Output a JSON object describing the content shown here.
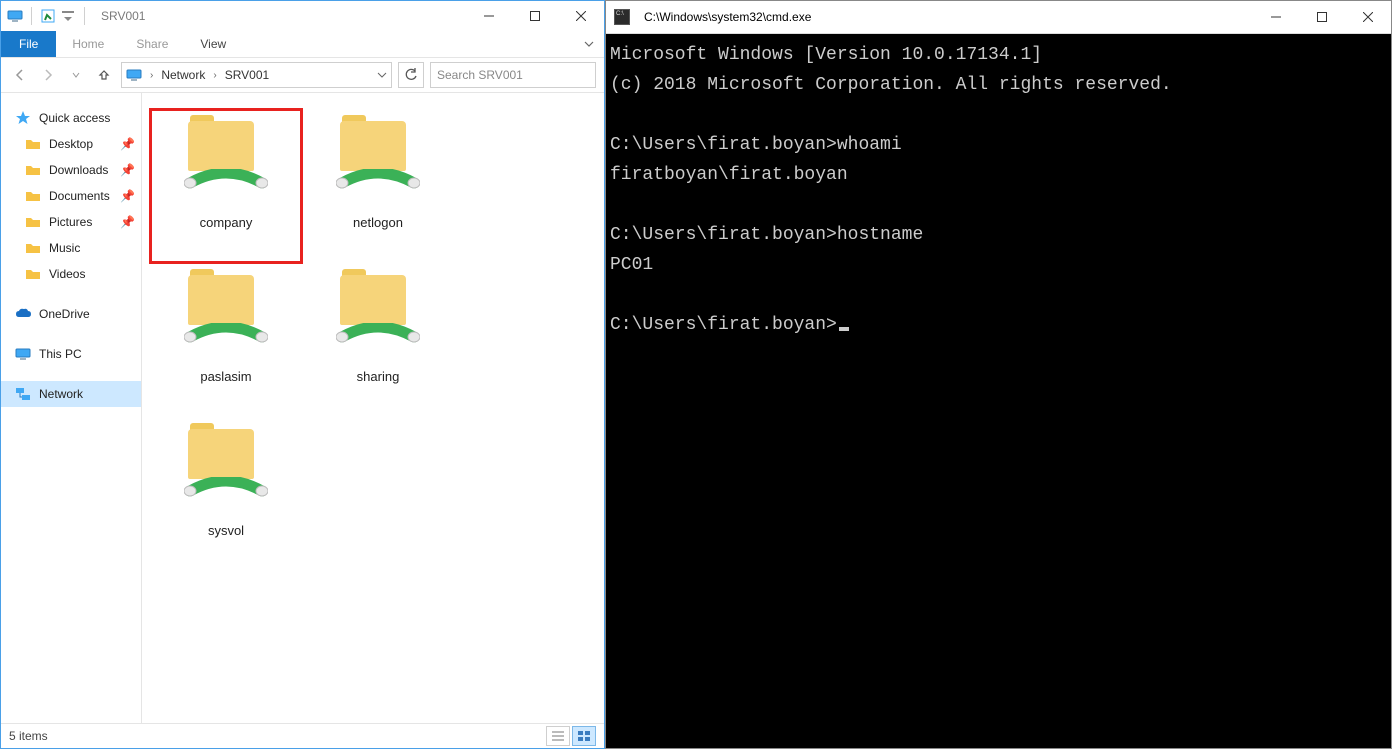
{
  "explorer": {
    "title": "SRV001",
    "tabs": [
      "File",
      "Home",
      "Share",
      "View"
    ],
    "breadcrumb": [
      "Network",
      "SRV001"
    ],
    "search_placeholder": "Search SRV001",
    "nav": {
      "quick_access": "Quick access",
      "items": [
        "Desktop",
        "Downloads",
        "Documents",
        "Pictures",
        "Music",
        "Videos"
      ],
      "onedrive": "OneDrive",
      "this_pc": "This PC",
      "network": "Network"
    },
    "shares": [
      "company",
      "netlogon",
      "paslasim",
      "sharing",
      "sysvol"
    ],
    "status": "5 items",
    "selected_share": "company",
    "highlight_color": "#e8221f"
  },
  "cmd": {
    "title": "C:\\Windows\\system32\\cmd.exe",
    "lines": [
      "Microsoft Windows [Version 10.0.17134.1]",
      "(c) 2018 Microsoft Corporation. All rights reserved.",
      "C:\\Users\\firat.boyan>whoami",
      "firatboyan\\firat.boyan",
      "C:\\Users\\firat.boyan>hostname",
      "PC01",
      "C:\\Users\\firat.boyan>"
    ]
  }
}
